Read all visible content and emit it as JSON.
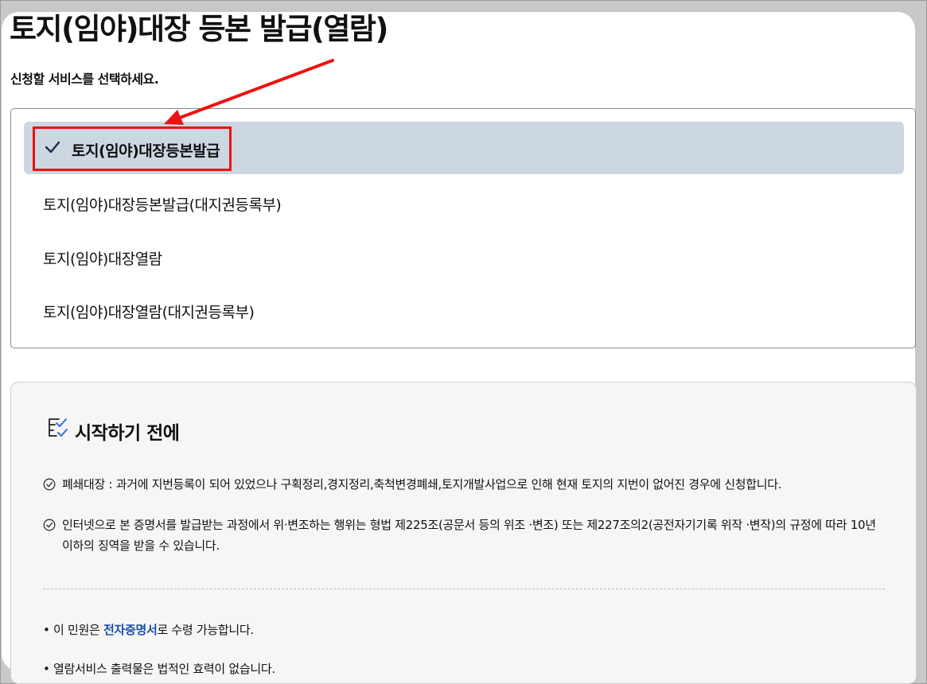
{
  "page": {
    "title": "토지(임야)대장 등본 발급(열람)",
    "subtitle": "신청할 서비스를 선택하세요."
  },
  "services": {
    "items": [
      {
        "label": "토지(임야)대장등본발급",
        "selected": true
      },
      {
        "label": "토지(임야)대장등본발급(대지권등록부)",
        "selected": false
      },
      {
        "label": "토지(임야)대장열람",
        "selected": false
      },
      {
        "label": "토지(임야)대장열람(대지권등록부)",
        "selected": false
      }
    ]
  },
  "annotation": {
    "color": "#ee1111"
  },
  "info": {
    "title": "시작하기 전에",
    "notices": [
      "폐쇄대장 : 과거에 지번등록이 되어 있었으나 구획정리,경지정리,축척변경폐쇄,토지개발사업으로 인해 현재 토지의 지번이 없어진 경우에 신청합니다.",
      "인터넷으로 본 증명서를 발급받는 과정에서 위·변조하는 행위는 형법 제225조(공문서 등의 위조 ·변조) 또는 제227조의2(공전자기기록 위작 ·변작)의 규정에 따라 10년 이하의 징역을 받을 수 있습니다."
    ],
    "bullets": {
      "first_prefix": "• 이 민원은 ",
      "first_highlight": "전자증명서",
      "first_suffix": "로 수령 가능합니다.",
      "second": "• 열람서비스 출력물은 법적인 효력이 없습니다."
    }
  }
}
